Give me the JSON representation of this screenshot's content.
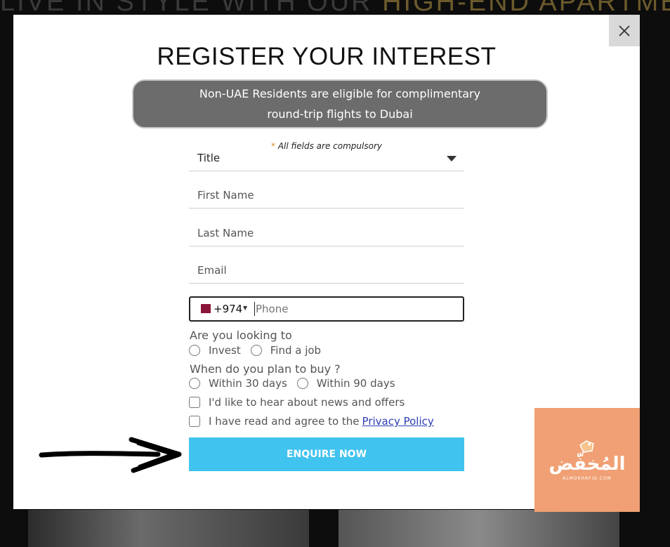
{
  "background": {
    "headline_prefix": "Live in style with our ",
    "headline_highlight": "high-end apartments"
  },
  "modal": {
    "title": "REGISTER YOUR INTEREST",
    "banner_line1": "Non-UAE Residents are eligible for complimentary",
    "banner_line2": "round-trip flights to Dubai",
    "compulsory_star": "*",
    "compulsory_text": " All fields are compulsory",
    "title_select": "Title",
    "first_name_placeholder": "First Name",
    "last_name_placeholder": "Last Name",
    "email_placeholder": "Email",
    "phone_code": "+974",
    "phone_placeholder": "Phone",
    "q1_label": "Are you looking to",
    "q1_options": [
      "Invest",
      "Find a job"
    ],
    "q2_label": "When do you plan to buy ?",
    "q2_options": [
      "Within 30 days",
      "Within 90 days"
    ],
    "news_checkbox": "I'd like to hear about news and offers",
    "privacy_checkbox": "I have read and agree to the",
    "privacy_link": "Privacy Policy",
    "submit_label": "ENQUIRE NOW",
    "close_symbol": "×"
  },
  "watermark": {
    "arabic": "المُخفّض",
    "sub": "ALMOKHAFID.COM"
  },
  "colors": {
    "submit_bg": "#41c3ef",
    "banner_bg": "#6c6c6c",
    "watermark_bg": "#f0a074",
    "link": "#2d3db4"
  }
}
